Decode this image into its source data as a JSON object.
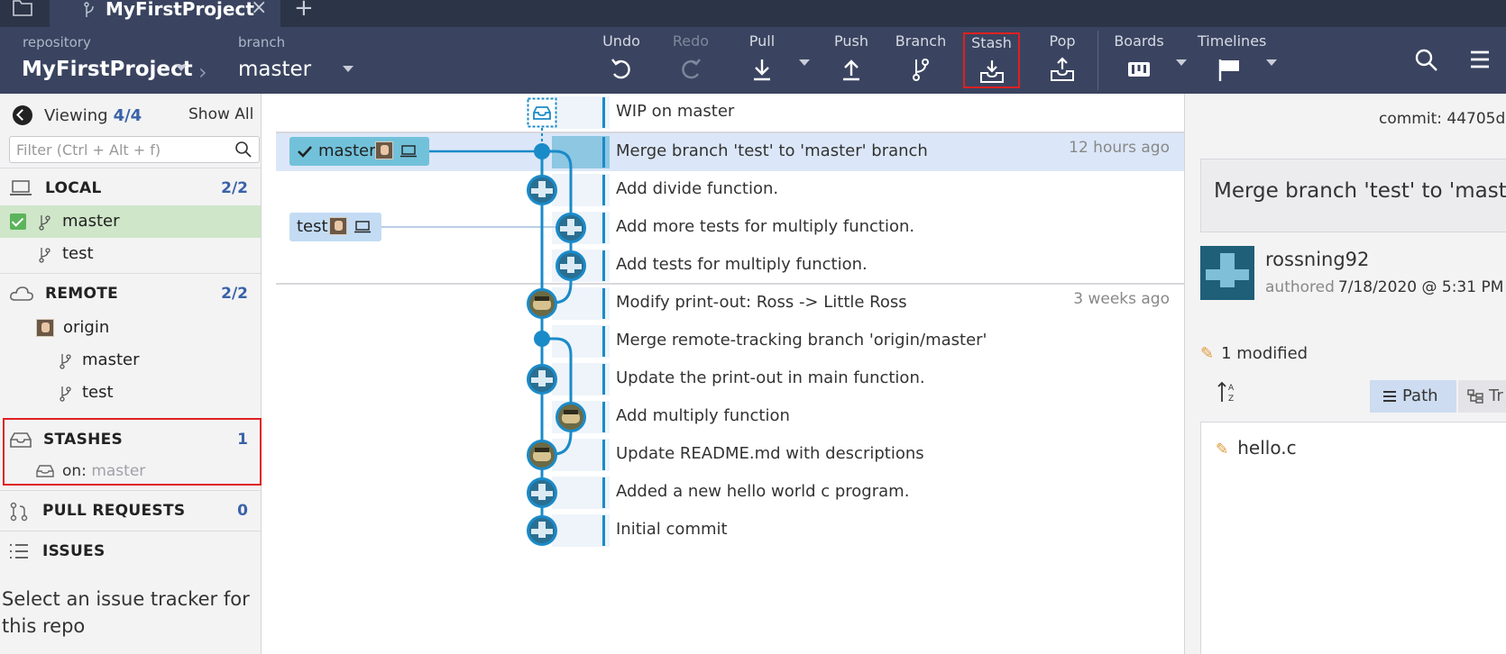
{
  "tab": {
    "title": "MyFirstProject"
  },
  "toolbar": {
    "repo_caption": "repository",
    "repo_name": "MyFirstProject",
    "branch_caption": "branch",
    "branch_name": "master",
    "undo": "Undo",
    "redo": "Redo",
    "pull": "Pull",
    "push": "Push",
    "branch": "Branch",
    "stash": "Stash",
    "pop": "Pop",
    "boards": "Boards",
    "timelines": "Timelines"
  },
  "sidebar": {
    "viewing_label": "Viewing",
    "viewing_count": "4/4",
    "show_all": "Show All",
    "filter_placeholder": "Filter (Ctrl + Alt + f)",
    "local": {
      "title": "LOCAL",
      "count": "2/2",
      "items": [
        "master",
        "test"
      ]
    },
    "remote": {
      "title": "REMOTE",
      "count": "2/2",
      "origin": "origin",
      "items": [
        "master",
        "test"
      ]
    },
    "stashes": {
      "title": "STASHES",
      "count": "1",
      "on_label": "on:",
      "on_branch": "master"
    },
    "pull_requests": {
      "title": "PULL REQUESTS",
      "count": "0"
    },
    "issues": {
      "title": "ISSUES",
      "message": "Select an issue tracker for this repo"
    }
  },
  "graph": {
    "refs": {
      "master": "master",
      "test": "test"
    },
    "commits": [
      {
        "message": "WIP on master",
        "time": ""
      },
      {
        "message": "Merge branch 'test' to 'master' branch",
        "time": "12 hours ago"
      },
      {
        "message": "Add divide function.",
        "time": ""
      },
      {
        "message": "Add more tests for multiply function.",
        "time": ""
      },
      {
        "message": "Add tests for multiply function.",
        "time": ""
      },
      {
        "message": "Modify print-out: Ross -> Little Ross",
        "time": "3 weeks ago"
      },
      {
        "message": "Merge remote-tracking branch 'origin/master'",
        "time": ""
      },
      {
        "message": "Update the print-out in main function.",
        "time": ""
      },
      {
        "message": "Add multiply function",
        "time": ""
      },
      {
        "message": "Update README.md with descriptions",
        "time": ""
      },
      {
        "message": "Added a new hello world c program.",
        "time": ""
      },
      {
        "message": "Initial commit",
        "time": ""
      }
    ]
  },
  "details": {
    "commit_label": "commit:",
    "commit_sha": "44705d",
    "message": "Merge branch 'test' to 'master",
    "author": "rossning92",
    "authored_label": "authored",
    "authored_date": "7/18/2020 @ 5:31 PM",
    "modified": "1 modified",
    "path_btn": "Path",
    "tree_btn": "Tr",
    "file": "hello.c"
  },
  "colors": {
    "accent": "#1a8bc9",
    "toolbar_bg": "#3a4460",
    "highlight": "#e02020"
  }
}
